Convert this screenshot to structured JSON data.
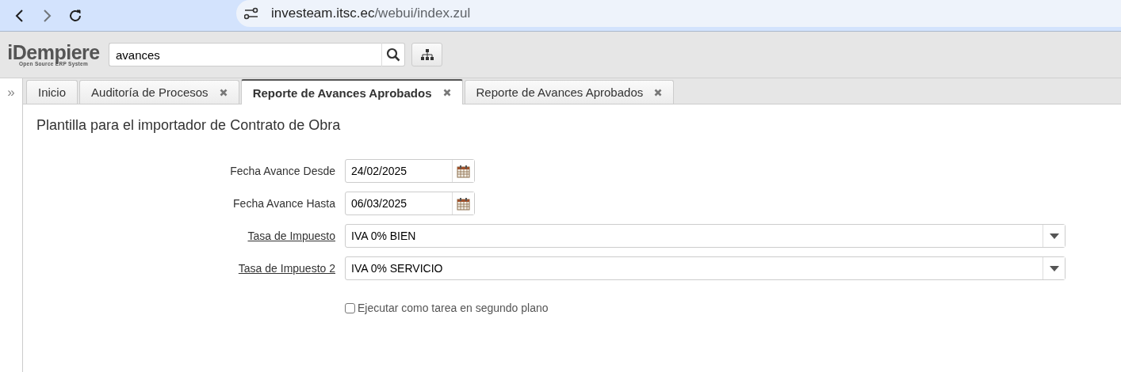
{
  "browser": {
    "url_host": "investeam.itsc.ec",
    "url_path": "/webui/index.zul"
  },
  "header": {
    "logo": "iDempiere",
    "logo_subtitle": "Open Source ERP System",
    "search_value": "avances"
  },
  "tabs": [
    {
      "label": "Inicio",
      "selected": false,
      "closable": false
    },
    {
      "label": "Auditoría de Procesos",
      "selected": false,
      "closable": true
    },
    {
      "label": "Reporte de Avances Aprobados",
      "selected": true,
      "closable": true
    },
    {
      "label": "Reporte de Avances Aprobados",
      "selected": false,
      "closable": true
    }
  ],
  "sidebar": {
    "toggle": "»"
  },
  "form": {
    "title": "Plantilla para el importador de Contrato de Obra",
    "fields": [
      {
        "kind": "date",
        "label": "Fecha Avance Desde",
        "value": "24/02/2025",
        "link": false
      },
      {
        "kind": "date",
        "label": "Fecha Avance Hasta",
        "value": "06/03/2025",
        "link": false
      },
      {
        "kind": "select",
        "label": "Tasa de Impuesto",
        "value": "IVA 0% BIEN",
        "link": true
      },
      {
        "kind": "select",
        "label": "Tasa de Impuesto 2",
        "value": "IVA 0% SERVICIO",
        "link": true
      }
    ],
    "background_option": {
      "label": "Ejecutar como tarea en segundo plano",
      "checked": false
    }
  }
}
